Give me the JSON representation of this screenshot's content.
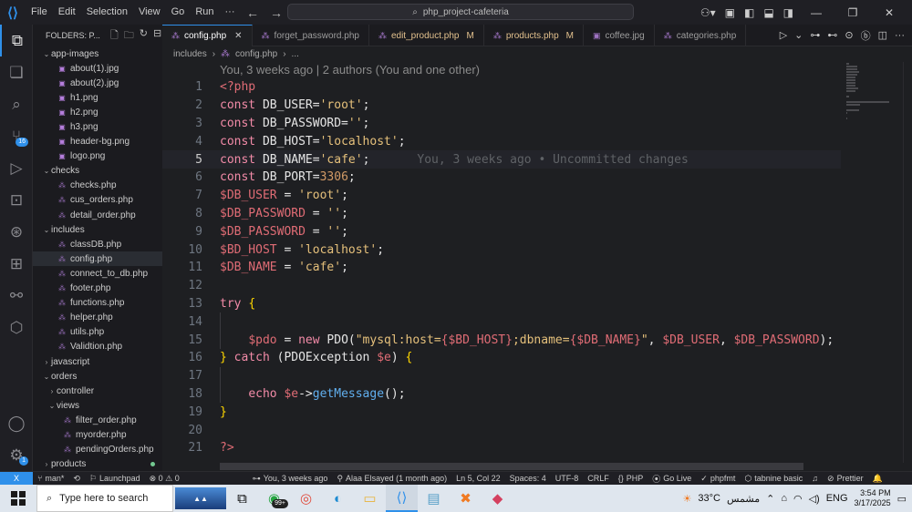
{
  "menu": [
    "File",
    "Edit",
    "Selection",
    "View",
    "Go",
    "Run",
    "···"
  ],
  "command_center": "php_project-cafeteria",
  "sidebar": {
    "header": "FOLDERS: P...",
    "items": [
      {
        "label": "app-images",
        "type": "folder",
        "open": true,
        "depth": 0
      },
      {
        "label": "about(1).jpg",
        "type": "img",
        "depth": 1
      },
      {
        "label": "about(2).jpg",
        "type": "img",
        "depth": 1
      },
      {
        "label": "h1.png",
        "type": "img",
        "depth": 1
      },
      {
        "label": "h2.png",
        "type": "img",
        "depth": 1
      },
      {
        "label": "h3.png",
        "type": "img",
        "depth": 1
      },
      {
        "label": "header-bg.png",
        "type": "img",
        "depth": 1
      },
      {
        "label": "logo.png",
        "type": "img",
        "depth": 1
      },
      {
        "label": "checks",
        "type": "folder",
        "open": true,
        "depth": 0
      },
      {
        "label": "checks.php",
        "type": "php",
        "depth": 1
      },
      {
        "label": "cus_orders.php",
        "type": "php",
        "depth": 1
      },
      {
        "label": "detail_order.php",
        "type": "php",
        "depth": 1
      },
      {
        "label": "includes",
        "type": "folder",
        "open": true,
        "depth": 0
      },
      {
        "label": "classDB.php",
        "type": "php",
        "depth": 1
      },
      {
        "label": "config.php",
        "type": "php",
        "depth": 1,
        "selected": true
      },
      {
        "label": "connect_to_db.php",
        "type": "php",
        "depth": 1
      },
      {
        "label": "footer.php",
        "type": "php",
        "depth": 1
      },
      {
        "label": "functions.php",
        "type": "php",
        "depth": 1
      },
      {
        "label": "helper.php",
        "type": "php",
        "depth": 1
      },
      {
        "label": "utils.php",
        "type": "php",
        "depth": 1
      },
      {
        "label": "Validtion.php",
        "type": "php",
        "depth": 1
      },
      {
        "label": "javascript",
        "type": "folder",
        "open": false,
        "depth": 0
      },
      {
        "label": "orders",
        "type": "folder",
        "open": true,
        "depth": 0
      },
      {
        "label": "controller",
        "type": "folder",
        "open": false,
        "depth": 1
      },
      {
        "label": "views",
        "type": "folder",
        "open": true,
        "depth": 1
      },
      {
        "label": "filter_order.php",
        "type": "php",
        "depth": 2
      },
      {
        "label": "myorder.php",
        "type": "php",
        "depth": 2
      },
      {
        "label": "pendingOrders.php",
        "type": "php",
        "depth": 2
      },
      {
        "label": "products",
        "type": "folder",
        "open": false,
        "depth": 0,
        "modified": true
      }
    ]
  },
  "tabs": [
    {
      "label": "config.php",
      "active": true,
      "modified": false
    },
    {
      "label": "forget_password.php",
      "active": false,
      "modified": false
    },
    {
      "label": "edit_product.php",
      "active": false,
      "modified": true,
      "flag": "M"
    },
    {
      "label": "products.php",
      "active": false,
      "modified": true,
      "flag": "M"
    },
    {
      "label": "coffee.jpg",
      "active": false,
      "modified": false
    },
    {
      "label": "categories.php",
      "active": false,
      "modified": false
    }
  ],
  "breadcrumb": [
    "includes",
    "config.php",
    "..."
  ],
  "editor": {
    "blame_header": "You, 3 weeks ago | 2 authors (You and one other)",
    "inline_blame": "You, 3 weeks ago • Uncommitted changes",
    "current_line": 5,
    "lines": [
      {
        "n": "1",
        "tokens": [
          [
            "c-tag",
            "<?php"
          ]
        ]
      },
      {
        "n": "2",
        "tokens": [
          [
            "c-kw",
            "const"
          ],
          [
            "c-plain",
            " DB_USER="
          ],
          [
            "c-str",
            "'root'"
          ],
          [
            "c-punc",
            ";"
          ]
        ]
      },
      {
        "n": "3",
        "tokens": [
          [
            "c-kw",
            "const"
          ],
          [
            "c-plain",
            " DB_PASSWORD="
          ],
          [
            "c-str",
            "''"
          ],
          [
            "c-punc",
            ";"
          ]
        ]
      },
      {
        "n": "4",
        "tokens": [
          [
            "c-kw",
            "const"
          ],
          [
            "c-plain",
            " DB_HOST="
          ],
          [
            "c-str",
            "'localhost'"
          ],
          [
            "c-punc",
            ";"
          ]
        ]
      },
      {
        "n": "5",
        "tokens": [
          [
            "c-kw",
            "const"
          ],
          [
            "c-plain",
            " DB_NAME="
          ],
          [
            "c-str",
            "'cafe'"
          ],
          [
            "c-punc",
            ";"
          ]
        ]
      },
      {
        "n": "6",
        "tokens": [
          [
            "c-kw",
            "const"
          ],
          [
            "c-plain",
            " DB_PORT="
          ],
          [
            "c-num",
            "3306"
          ],
          [
            "c-punc",
            ";"
          ]
        ]
      },
      {
        "n": "7",
        "tokens": [
          [
            "c-var",
            "$DB_USER"
          ],
          [
            "c-plain",
            " = "
          ],
          [
            "c-str",
            "'root'"
          ],
          [
            "c-punc",
            ";"
          ]
        ]
      },
      {
        "n": "8",
        "tokens": [
          [
            "c-var",
            "$DB_PASSWORD"
          ],
          [
            "c-plain",
            " = "
          ],
          [
            "c-str",
            "''"
          ],
          [
            "c-punc",
            ";"
          ]
        ]
      },
      {
        "n": "9",
        "tokens": [
          [
            "c-var",
            "$DB_PASSWORD"
          ],
          [
            "c-plain",
            " = "
          ],
          [
            "c-str",
            "''"
          ],
          [
            "c-punc",
            ";"
          ]
        ]
      },
      {
        "n": "10",
        "tokens": [
          [
            "c-var",
            "$BD_HOST"
          ],
          [
            "c-plain",
            " = "
          ],
          [
            "c-str",
            "'localhost'"
          ],
          [
            "c-punc",
            ";"
          ]
        ]
      },
      {
        "n": "11",
        "tokens": [
          [
            "c-var",
            "$DB_NAME"
          ],
          [
            "c-plain",
            " = "
          ],
          [
            "c-str",
            "'cafe'"
          ],
          [
            "c-punc",
            ";"
          ]
        ]
      },
      {
        "n": "12",
        "tokens": []
      },
      {
        "n": "13",
        "tokens": [
          [
            "c-kw",
            "try"
          ],
          [
            "c-plain",
            " "
          ],
          [
            "c-brace",
            "{"
          ]
        ]
      },
      {
        "n": "14",
        "tokens": []
      },
      {
        "n": "15",
        "tokens": [
          [
            "c-plain",
            "    "
          ],
          [
            "c-var",
            "$pdo"
          ],
          [
            "c-plain",
            " = "
          ],
          [
            "c-kw",
            "new"
          ],
          [
            "c-plain",
            " PDO("
          ],
          [
            "c-str",
            "\"mysql:host="
          ],
          [
            "c-var",
            "{$BD_HOST}"
          ],
          [
            "c-str",
            ";dbname="
          ],
          [
            "c-var",
            "{$DB_NAME}"
          ],
          [
            "c-str",
            "\""
          ],
          [
            "c-plain",
            ", "
          ],
          [
            "c-var",
            "$DB_USER"
          ],
          [
            "c-plain",
            ", "
          ],
          [
            "c-var",
            "$DB_PASSWORD"
          ],
          [
            "c-plain",
            ");"
          ]
        ]
      },
      {
        "n": "16",
        "tokens": [
          [
            "c-brace",
            "}"
          ],
          [
            "c-plain",
            " "
          ],
          [
            "c-kw",
            "catch"
          ],
          [
            "c-plain",
            " (PDOException "
          ],
          [
            "c-var",
            "$e"
          ],
          [
            "c-plain",
            ") "
          ],
          [
            "c-brace",
            "{"
          ]
        ]
      },
      {
        "n": "17",
        "tokens": []
      },
      {
        "n": "18",
        "tokens": [
          [
            "c-plain",
            "    "
          ],
          [
            "c-kw",
            "echo"
          ],
          [
            "c-plain",
            " "
          ],
          [
            "c-var",
            "$e"
          ],
          [
            "c-plain",
            "->"
          ],
          [
            "c-fn",
            "getMessage"
          ],
          [
            "c-plain",
            "();"
          ]
        ]
      },
      {
        "n": "19",
        "tokens": [
          [
            "c-brace",
            "}"
          ]
        ]
      },
      {
        "n": "20",
        "tokens": []
      },
      {
        "n": "21",
        "tokens": [
          [
            "c-tag",
            "?>"
          ]
        ]
      }
    ]
  },
  "statusbar": {
    "remote": "X",
    "branch": "man*",
    "launchpad": "Launchpad",
    "problems": "⊗ 0 ⚠ 0",
    "blame": "You, 3 weeks ago",
    "author": "Alaa Elsayed (1 month ago)",
    "position": "Ln 5, Col 22",
    "spaces": "Spaces: 4",
    "encoding": "UTF-8",
    "eol": "CRLF",
    "language": "PHP",
    "golive": "Go Live",
    "phpfmt": "phpfmt",
    "tabnine": "tabnine basic",
    "prettier": "Prettier"
  },
  "taskbar": {
    "search_placeholder": "Type here to search",
    "whatsapp_badge": "99+",
    "weather": "33°C",
    "weather_label": "مشمس",
    "lang": "ENG",
    "time": "3:54 PM",
    "date": "3/17/2025"
  }
}
